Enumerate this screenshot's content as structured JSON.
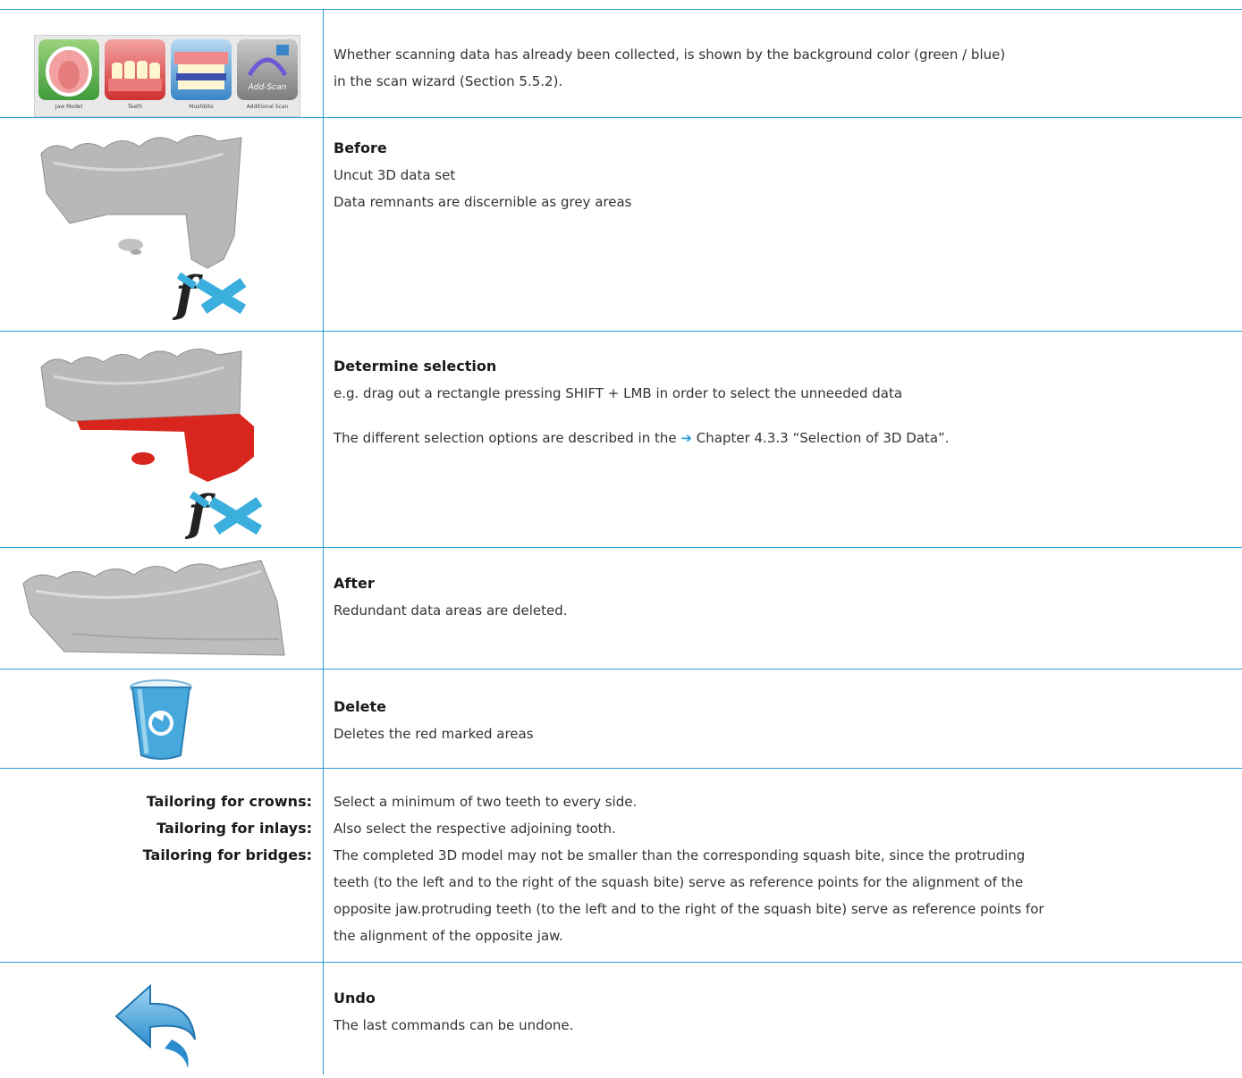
{
  "rows": [
    {
      "id": "scan-wizard",
      "image": "scan-wizard-buttons",
      "wizard_labels": [
        "Jaw Model",
        "Teeth",
        "Mushbite",
        "Additional Scan"
      ],
      "wizard_addscan_text": "Add-Scan",
      "lines": [
        "Whether scanning data has already been collected, is shown by the background color (green / blue)",
        "in the scan wizard (Section 5.5.2)."
      ]
    },
    {
      "id": "before",
      "image": "uncut-jaw-model",
      "title": "Before",
      "lines": [
        "Uncut 3D data set",
        "Data remnants are discernible as grey areas"
      ]
    },
    {
      "id": "selection",
      "image": "selected-jaw-model",
      "title": "Determine selection",
      "lines": [
        "e.g. drag out a rectangle pressing SHIFT + LMB in order to select the unneeded data"
      ],
      "ref_prefix": "The different selection options are described in the",
      "ref_arrow": "➔",
      "ref_text": "Chapter 4.3.3 “Selection of 3D Data”."
    },
    {
      "id": "after",
      "image": "cut-jaw-model",
      "title": "After",
      "lines": [
        "Redundant data areas are deleted."
      ]
    },
    {
      "id": "delete",
      "image": "recycle-bin-icon",
      "title": "Delete",
      "lines": [
        "Deletes the red marked areas"
      ]
    },
    {
      "id": "tailoring",
      "labels": [
        "Tailoring for crowns:",
        "Tailoring for inlays:",
        "Tailoring for bridges:"
      ],
      "lines": [
        "Select a minimum of two teeth to every side.",
        "Also select the respective adjoining tooth.",
        "The completed 3D model may not be smaller than the corresponding squash bite, since the protruding",
        "teeth (to the left and to the right of the squash bite) serve as reference points for the alignment of the",
        "opposite jaw.protruding teeth (to the left and to the right of the squash bite) serve as reference points for",
        "the alignment of the opposite jaw."
      ]
    },
    {
      "id": "undo",
      "image": "undo-arrow-icon",
      "title": "Undo",
      "lines": [
        "The last commands can be undone."
      ]
    }
  ],
  "colors": {
    "rule": "#2e9bd6",
    "selection_red": "#d8261e",
    "model_grey": "#b8b8b8",
    "logo_blue": "#3aaedc"
  }
}
